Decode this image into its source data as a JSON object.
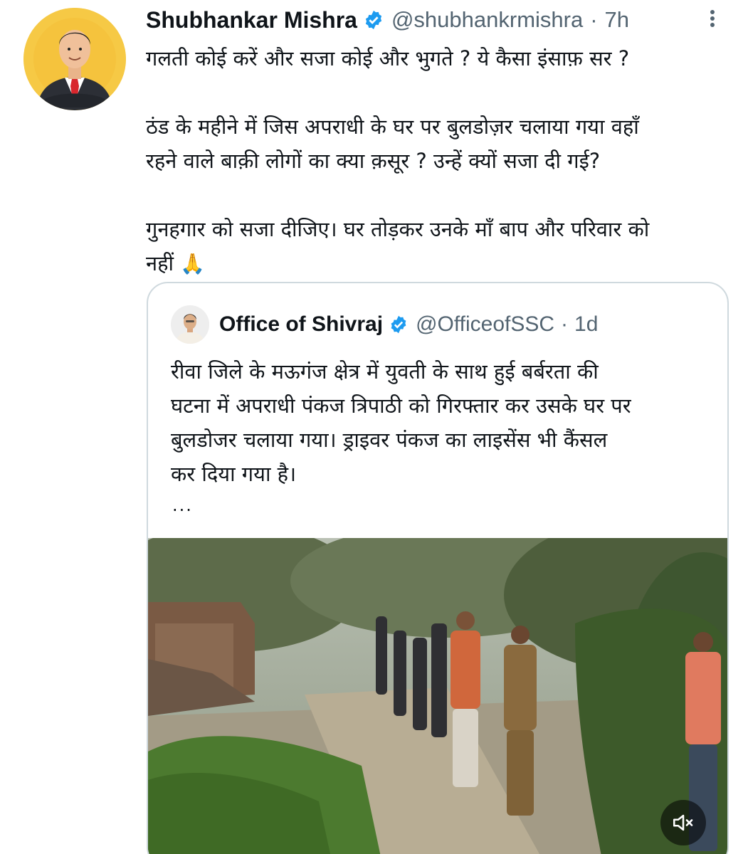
{
  "tweet": {
    "author_name": "Shubhankar Mishra",
    "handle": "@shubhankrmishra",
    "separator": "·",
    "time": "7h",
    "avatar_icon": "avatar-illustration",
    "verified_icon": "verified-badge-icon",
    "more_icon": "more-options-icon",
    "text_lines": [
      "गलती कोई करें और सजा कोई और भुगते ? ये कैसा इंसाफ़ सर ?",
      "",
      "ठंड के महीने में जिस अपराधी के घर पर बुलडोज़र चलाया गया वहाँ",
      "रहने वाले बाक़ी लोगों का क्या क़सूर ? उन्हें क्यों सजा दी गई?",
      "",
      "गुनहगार को सजा दीजिए। घर तोड़कर उनके माँ बाप और परिवार को",
      "नहीं"
    ],
    "emoji": "🙏"
  },
  "quoted_tweet": {
    "author_name": "Office of Shivraj",
    "handle": "@OfficeofSSC",
    "separator": "·",
    "time": "1d",
    "text_lines": [
      "रीवा जिले के मऊगंज क्षेत्र में युवती के साथ हुई बर्बरता की",
      "घटना में अपराधी पंकज त्रिपाठी को गिरफ्तार कर उसके घर पर",
      "बुलडोजर चलाया गया। ड्राइवर पंकज का लाइसेंस भी कैंसल",
      "कर दिया गया है।"
    ],
    "ellipsis": "...",
    "media_icon": "video-thumbnail",
    "mute_icon": "speaker-muted-icon"
  },
  "colors": {
    "text_primary": "#0f1419",
    "text_secondary": "#536471",
    "verified_blue": "#1d9bf0",
    "border": "#cfd9de",
    "avatar_bg": "#f3c437"
  }
}
